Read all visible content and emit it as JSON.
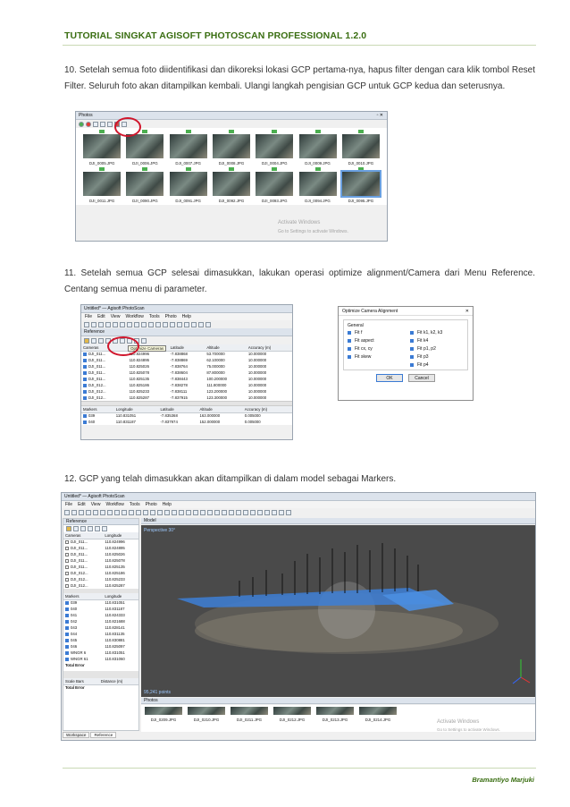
{
  "header": {
    "title": "TUTORIAL SINGKAT AGISOFT PHOTOSCAN PROFESSIONAL 1.2.0"
  },
  "paragraphs": {
    "p10": "10. Setelah semua foto diidentifikasi dan dikoreksi lokasi GCP pertama-nya, hapus filter dengan cara klik tombol Reset Filter. Seluruh foto akan ditampilkan kembali. Ulangi langkah pengisian GCP untuk GCP kedua dan seterusnya.",
    "p11": "11. Setelah semua GCP selesai dimasukkan, lakukan operasi optimize alignment/Camera dari Menu Reference. Centang semua menu di parameter.",
    "p12": "12. GCP yang telah dimasukkan akan ditampilkan di dalam model sebagai Markers."
  },
  "footer": {
    "author": "Bramantiyo Marjuki"
  },
  "shot1": {
    "title": "Photos",
    "row1": [
      "DJI_0005.JPG",
      "DJI_0006.JPG",
      "DJI_0007.JPG",
      "DJI_0008.JPG",
      "DJI_0004.JPG",
      "DJI_0009.JPG",
      "DJI_0010.JPG"
    ],
    "row2": [
      "DJI_0011.JPG",
      "DJI_0090.JPG",
      "DJI_0091.JPG",
      "DJI_0092.JPG",
      "DJI_0093.JPG",
      "DJI_0094.JPG",
      "DJI_0095.JPG"
    ],
    "watermark1": "Activate Windows",
    "watermark2": "Go to Settings to activate Windows."
  },
  "shot2": {
    "title": "Untitled* — Agisoft PhotoScan",
    "menu": [
      "File",
      "Edit",
      "View",
      "Workflow",
      "Tools",
      "Photo",
      "Help"
    ],
    "panel": "Reference",
    "tooltip": "Optimize Cameras",
    "cam_headers": [
      "Cameras",
      "Longitude",
      "Latitude",
      "Altitude",
      "Accuracy (m)"
    ],
    "cameras": [
      [
        "DJI_011...",
        "110.824996",
        "-7.838868",
        "53.700000",
        "10.000000"
      ],
      [
        "DJI_011...",
        "110.824895",
        "-7.838869",
        "62.100000",
        "10.000000"
      ],
      [
        "DJI_011...",
        "110.825026",
        "-7.838764",
        "75.000000",
        "10.000000"
      ],
      [
        "DJI_011...",
        "110.825078",
        "-7.838604",
        "87.800000",
        "10.000000"
      ],
      [
        "DJI_011...",
        "110.825135",
        "-7.838443",
        "100.200000",
        "10.000000"
      ],
      [
        "DJI_012...",
        "110.825186",
        "-7.838278",
        "111.800000",
        "10.000000"
      ],
      [
        "DJI_012...",
        "110.825233",
        "-7.838111",
        "123.200000",
        "10.000000"
      ],
      [
        "DJI_012...",
        "110.825287",
        "-7.837915",
        "123.300000",
        "10.000000"
      ]
    ],
    "mk_headers": [
      "Markers",
      "Longitude",
      "Latitude",
      "Altitude",
      "Accuracy (m)"
    ],
    "markers": [
      [
        "039",
        "110.831051",
        "-7.835368",
        "163.000000",
        "0.005000"
      ],
      [
        "040",
        "110.831187",
        "-7.837974",
        "152.000000",
        "0.005000"
      ]
    ]
  },
  "dialog": {
    "title": "Optimize Camera Alignment",
    "close": "✕",
    "group": "General",
    "left": [
      "Fit f",
      "Fit aspect",
      "Fit cx, cy",
      "Fit skew"
    ],
    "right": [
      "Fit k1, k2, k3",
      "Fit k4",
      "Fit p1, p2",
      "Fit p3",
      "Fit p4"
    ],
    "ok": "OK",
    "cancel": "Cancel"
  },
  "shot3": {
    "title": "Untitled* — Agisoft PhotoScan",
    "menu": [
      "File",
      "Edit",
      "View",
      "Workflow",
      "Tools",
      "Photo",
      "Help"
    ],
    "panel": "Reference",
    "model_tab": "Model",
    "perspective": "Perspective 30°",
    "points": "95,241 points",
    "cam_headers": [
      "Cameras",
      "Longitude"
    ],
    "cameras": [
      [
        "DJI_011...",
        "110.824996"
      ],
      [
        "DJI_011...",
        "110.824895"
      ],
      [
        "DJI_011...",
        "110.825026"
      ],
      [
        "DJI_011...",
        "110.825078"
      ],
      [
        "DJI_011...",
        "110.825135"
      ],
      [
        "DJI_012...",
        "110.825186"
      ],
      [
        "DJI_012...",
        "110.825233"
      ],
      [
        "DJI_012...",
        "110.825287"
      ]
    ],
    "mk_headers": [
      "Markers",
      "Longitude"
    ],
    "markers": [
      [
        "039",
        "110.831051"
      ],
      [
        "040",
        "110.831187"
      ],
      [
        "041",
        "110.824333"
      ],
      [
        "042",
        "110.821688"
      ],
      [
        "043",
        "110.828141"
      ],
      [
        "044",
        "110.831135"
      ],
      [
        "045",
        "110.830881"
      ],
      [
        "046",
        "110.825097"
      ],
      [
        "WNGR 6",
        "110.831051"
      ],
      [
        "WNGR 61",
        "110.831060"
      ]
    ],
    "total_error": "Total Error",
    "scale_headers": [
      "Scale Bars",
      "Distance (m)"
    ],
    "scale_total": "Total Error",
    "photos_tab": "Photos",
    "photos": [
      "DJI_0209.JPG",
      "DJI_0210.JPG",
      "DJI_0211.JPG",
      "DJI_0212.JPG",
      "DJI_0213.JPG",
      "DJI_0214.JPG"
    ],
    "tabs": [
      "Workspace",
      "Reference"
    ],
    "watermark1": "Activate Windows",
    "watermark2": "Go to Settings to activate Windows."
  }
}
